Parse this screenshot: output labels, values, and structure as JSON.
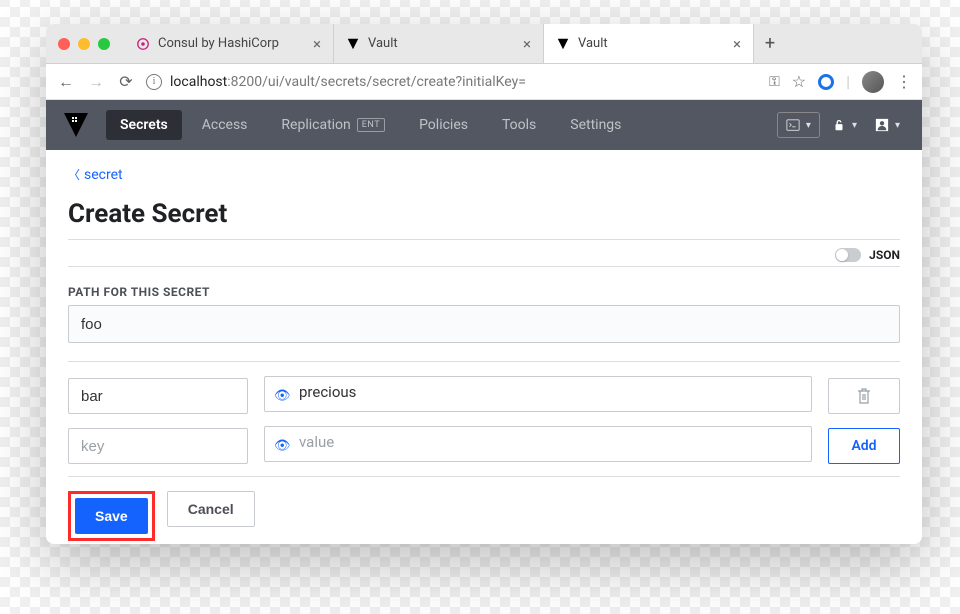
{
  "tabs": [
    {
      "title": "Consul by HashiCorp",
      "active": false
    },
    {
      "title": "Vault",
      "active": false
    },
    {
      "title": "Vault",
      "active": true
    }
  ],
  "url": {
    "host": "localhost",
    "path": ":8200/ui/vault/secrets/secret/create?initialKey="
  },
  "nav": {
    "items": [
      "Secrets",
      "Access",
      "Replication",
      "Policies",
      "Tools",
      "Settings"
    ],
    "badge": "ENT"
  },
  "breadcrumb": {
    "label": "secret"
  },
  "page": {
    "title": "Create Secret",
    "json_label": "JSON",
    "path_label": "PATH FOR THIS SECRET",
    "path_value": "foo"
  },
  "kv": {
    "rows": [
      {
        "key": "bar",
        "value": "precious"
      },
      {
        "key": "",
        "value": ""
      }
    ],
    "key_placeholder": "key",
    "value_placeholder": "value",
    "add_label": "Add"
  },
  "actions": {
    "save": "Save",
    "cancel": "Cancel"
  }
}
